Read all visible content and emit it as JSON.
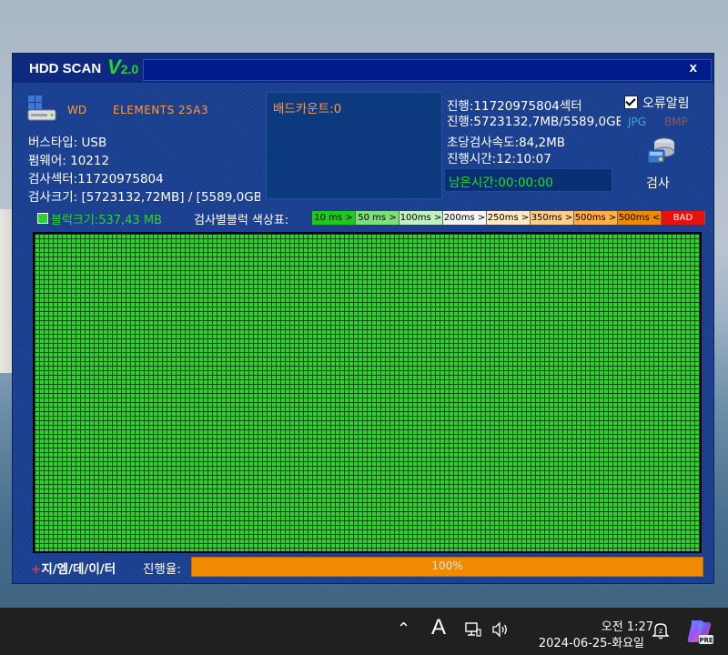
{
  "window": {
    "title": "HDD SCAN",
    "version_main": "V",
    "version_num": "2.0",
    "close": "x"
  },
  "drive": {
    "brand": "WD",
    "model": "ELEMENTS 25A3",
    "bus_type": "버스타입: USB",
    "firmware": "펌웨어: 10212",
    "sectors": "검사섹터:11720975804",
    "size": "검사크기: [5723132,72MB] / [5589,0GB"
  },
  "bad_count": "배드카운트:0",
  "progress": {
    "sectors": "진행:11720975804섹터",
    "bytes": "진행:5723132,7MB/5589,0GB",
    "speed": "초당검사속도:84,2MB",
    "elapsed": "진행시간:12:10:07",
    "remaining": "남은시간:00:00:00"
  },
  "options": {
    "error_alarm": "오류알림",
    "error_alarm_checked": true,
    "jpg": "JPG",
    "bmp": "BMP",
    "scan_button": "검사"
  },
  "legend": {
    "block_size": "블럭크기:537,43 MB",
    "title": "검사별블럭  색상표:",
    "items": [
      {
        "label": "10 ms >",
        "color": "#1ec81e"
      },
      {
        "label": "50 ms >",
        "color": "#7be07b"
      },
      {
        "label": "100ms >",
        "color": "#bff2bf"
      },
      {
        "label": "200ms >",
        "color": "#f4f4f4"
      },
      {
        "label": "250ms >",
        "color": "#ffe9c6"
      },
      {
        "label": "350ms >",
        "color": "#ffcf8a"
      },
      {
        "label": "500ms >",
        "color": "#ffae48"
      },
      {
        "label": "500ms <",
        "color": "#f08a00"
      },
      {
        "label": "BAD",
        "color": "#e81010"
      }
    ]
  },
  "footer": {
    "plus": "+",
    "logo": "지/엠/데/이/터",
    "rate_label": "진행율:",
    "rate_text": "100%",
    "rate_value": 1.0
  },
  "taskbar": {
    "chevron": "⌃",
    "ime": "A",
    "time": "오전 1:27",
    "date": "2024-06-25-화요일"
  }
}
